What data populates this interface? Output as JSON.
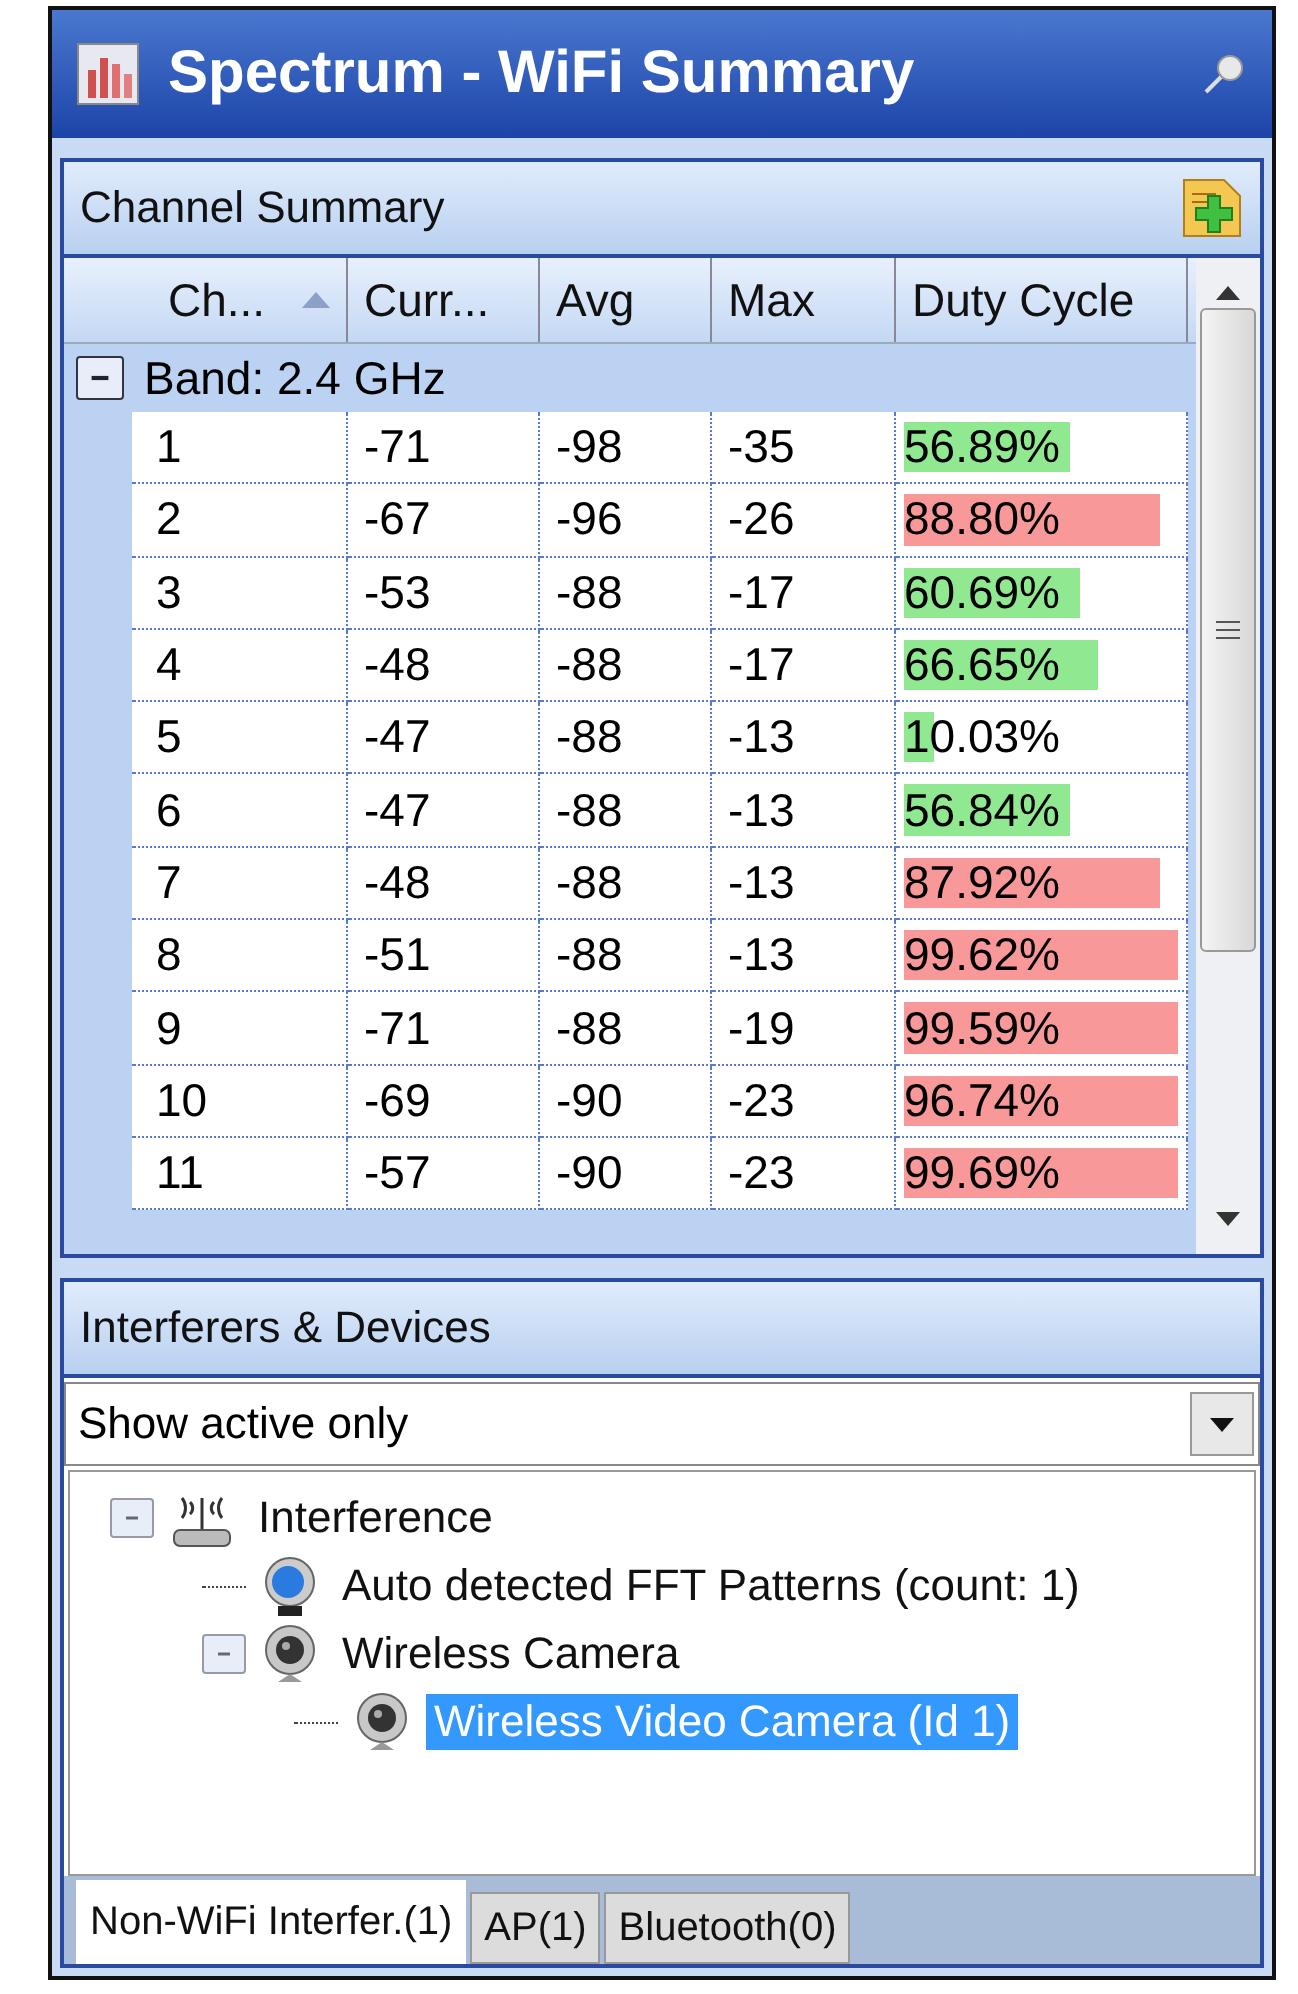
{
  "window": {
    "title": "Spectrum - WiFi Summary"
  },
  "channel_summary": {
    "title": "Channel Summary",
    "columns": [
      {
        "label": "Ch...",
        "sorted": true
      },
      {
        "label": "Curr...",
        "sorted": false
      },
      {
        "label": "Avg",
        "sorted": false
      },
      {
        "label": "Max",
        "sorted": false
      },
      {
        "label": "Duty Cycle",
        "sorted": false
      }
    ],
    "group": {
      "label": "Band:  2.4 GHz",
      "expanded": true
    },
    "rows": [
      {
        "channel": "1",
        "current": "-71",
        "avg": "-98",
        "max": "-35",
        "duty": "56.89%",
        "level": 0.57,
        "color": "#90e890"
      },
      {
        "channel": "2",
        "current": "-67",
        "avg": "-96",
        "max": "-26",
        "duty": "88.80%",
        "level": 0.88,
        "color": "#f89898"
      },
      {
        "channel": "3",
        "current": "-53",
        "avg": "-88",
        "max": "-17",
        "duty": "60.69%",
        "level": 0.61,
        "color": "#90e890"
      },
      {
        "channel": "4",
        "current": "-48",
        "avg": "-88",
        "max": "-17",
        "duty": "66.65%",
        "level": 0.67,
        "color": "#90e890"
      },
      {
        "channel": "5",
        "current": "-47",
        "avg": "-88",
        "max": "-13",
        "duty": "10.03%",
        "level": 0.1,
        "color": "#90e890"
      },
      {
        "channel": "6",
        "current": "-47",
        "avg": "-88",
        "max": "-13",
        "duty": "56.84%",
        "level": 0.57,
        "color": "#90e890"
      },
      {
        "channel": "7",
        "current": "-48",
        "avg": "-88",
        "max": "-13",
        "duty": "87.92%",
        "level": 0.88,
        "color": "#f89898"
      },
      {
        "channel": "8",
        "current": "-51",
        "avg": "-88",
        "max": "-13",
        "duty": "99.62%",
        "level": 1.0,
        "color": "#f89898"
      },
      {
        "channel": "9",
        "current": "-71",
        "avg": "-88",
        "max": "-19",
        "duty": "99.59%",
        "level": 1.0,
        "color": "#f89898"
      },
      {
        "channel": "10",
        "current": "-69",
        "avg": "-90",
        "max": "-23",
        "duty": "96.74%",
        "level": 0.97,
        "color": "#f89898"
      },
      {
        "channel": "11",
        "current": "-57",
        "avg": "-90",
        "max": "-23",
        "duty": "99.69%",
        "level": 1.0,
        "color": "#f89898"
      }
    ]
  },
  "interferers": {
    "title": "Interferers & Devices",
    "filter": {
      "value": "Show active only"
    },
    "tree": [
      {
        "label": "Interference",
        "kind": "antenna",
        "expanded": true,
        "selected": false,
        "children": [
          {
            "label": "Auto detected FFT Patterns (count: 1)",
            "kind": "pattern",
            "selected": false
          },
          {
            "label": "Wireless Camera",
            "kind": "camera",
            "expanded": true,
            "selected": false,
            "children": [
              {
                "label": "Wireless Video Camera (Id 1)",
                "kind": "camera",
                "selected": true
              }
            ]
          }
        ]
      }
    ],
    "tabs": [
      {
        "label": "Non-WiFi Interfer.(1)",
        "selected": true
      },
      {
        "label": "AP(1)",
        "selected": false
      },
      {
        "label": "Bluetooth(0)",
        "selected": false
      }
    ]
  }
}
